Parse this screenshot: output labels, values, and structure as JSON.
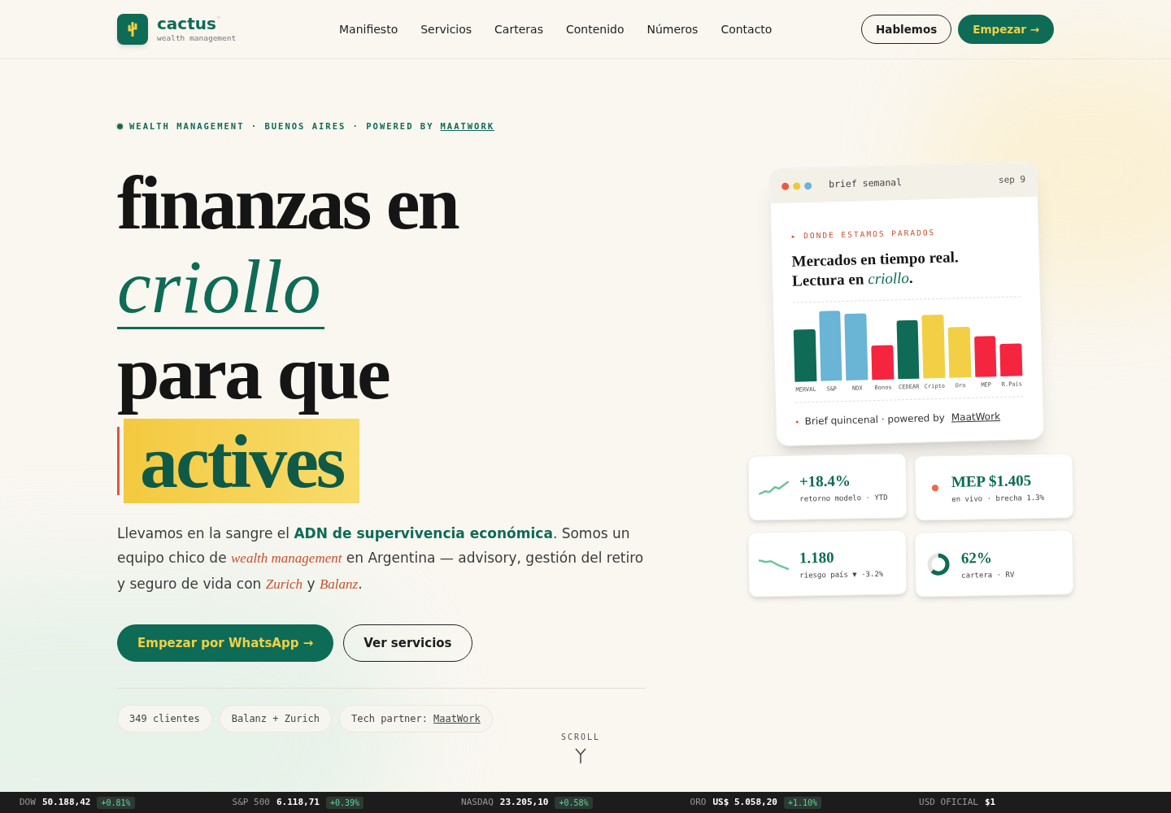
{
  "header": {
    "brand": "cactus",
    "brand_mark": "™",
    "tagline": "wealth management",
    "nav": [
      {
        "label": "Manifiesto"
      },
      {
        "label": "Servicios"
      },
      {
        "label": "Carteras"
      },
      {
        "label": "Contenido"
      },
      {
        "label": "Números"
      },
      {
        "label": "Contacto"
      }
    ],
    "secondary_button": "Hablemos",
    "primary_button": "Empezar →"
  },
  "hero": {
    "kicker": "WEALTH MANAGEMENT · BUENOS AIRES · POWERED BY",
    "kicker_link": "MAATWORK",
    "headline": [
      {
        "text": "finanzas en",
        "kind": "plain"
      },
      {
        "text": "criollo",
        "kind": "italic"
      },
      {
        "text": "para que",
        "kind": "plain"
      },
      {
        "text": "actives",
        "kind": "highlight"
      }
    ],
    "paragraph": "Llevamos en la sangre el **ADN de supervivencia económica**. Somos un equipo chico de *wealth management* en Argentina — advisory, gestión del retiro y seguro de vida con *Zurich* y *Balanz*.",
    "primary_button": "Empezar por WhatsApp →",
    "secondary_button": "Ver servicios",
    "chips": [
      {
        "text": "349 clientes"
      },
      {
        "text": "Balanz + Zurich"
      },
      {
        "text": "Tech partner:",
        "link": "MaatWork"
      }
    ],
    "scroll": "SCROLL"
  },
  "brief_card": {
    "title": "brief semanal",
    "date": "sep 9",
    "kicker": "▸ DONDE ESTAMOS PARADOS",
    "heading_1": "Mercados en tiempo real.",
    "heading_2": "Lectura en",
    "heading_accent": "criollo",
    "heading_end": ".",
    "bars": [
      {
        "label": "MERVAL",
        "color": "#0f6b55"
      },
      {
        "label": "S&P",
        "color": "#6ab4d6"
      },
      {
        "label": "NDX",
        "color": "#6ab4d6"
      },
      {
        "label": "Bonos",
        "color": "#f5243f"
      },
      {
        "label": "CEDEAR",
        "color": "#0f6b55"
      },
      {
        "label": "Cripto",
        "color": "#f2cf45"
      },
      {
        "label": "Oro",
        "color": "#f2cf45"
      },
      {
        "label": "MEP",
        "color": "#f5243f"
      },
      {
        "label": "R.Pais",
        "color": "#f5243f"
      }
    ],
    "footer": "Brief quincenal · powered by",
    "footer_link": "MaatWork"
  },
  "stats": [
    {
      "kind": "up",
      "value": "+18.4%",
      "caption": "retorno modelo · YTD"
    },
    {
      "kind": "live",
      "value": "MEP $1.405",
      "caption": "en vivo · brecha 1.3%"
    },
    {
      "kind": "down",
      "value": "1.180",
      "caption": "riesgo país ▼ -3.2%"
    },
    {
      "kind": "donut",
      "value": "62%",
      "caption": "cartera · RV"
    }
  ],
  "ticker": [
    {
      "name": "DOW",
      "value": "50.188,42",
      "change": "+0.81%"
    },
    {
      "name": "S&P 500",
      "value": "6.118,71",
      "change": "+0.39%"
    },
    {
      "name": "NASDAQ",
      "value": "23.205,10",
      "change": "+0.58%"
    },
    {
      "name": "ORO",
      "value": "US$ 5.058,20",
      "change": "+1.10%"
    },
    {
      "name": "USD OFICIAL",
      "value": "$1"
    }
  ]
}
